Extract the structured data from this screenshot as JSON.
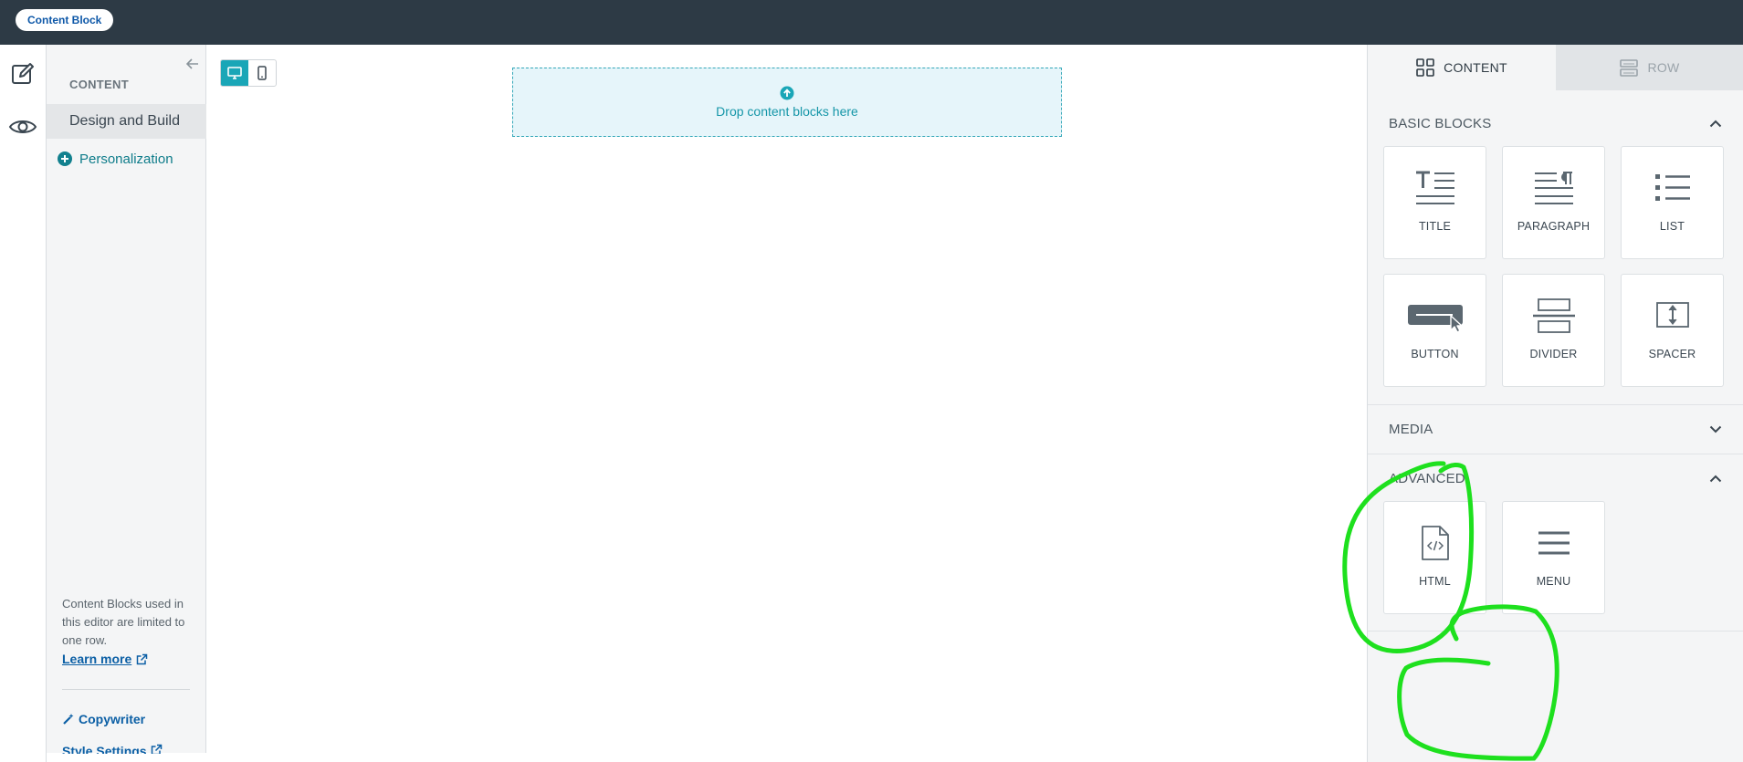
{
  "header": {
    "badge": "Content Block"
  },
  "rail": {
    "items": [
      {
        "icon": "edit-icon"
      },
      {
        "icon": "eye-icon"
      }
    ]
  },
  "nav": {
    "heading": "CONTENT",
    "active_item": "Design and Build",
    "personalization": "Personalization",
    "note": "Content Blocks used in this editor are limited to one row.",
    "learn_more": "Learn more",
    "copywriter": "Copywriter",
    "style_settings": "Style Settings"
  },
  "canvas": {
    "drop_text": "Drop content blocks here"
  },
  "sidebar": {
    "tabs": [
      {
        "label": "CONTENT",
        "icon": "grid-icon",
        "active": true
      },
      {
        "label": "ROW",
        "icon": "rows-icon",
        "active": false
      }
    ],
    "basic": {
      "title": "BASIC BLOCKS",
      "blocks": [
        "TITLE",
        "PARAGRAPH",
        "LIST",
        "BUTTON",
        "DIVIDER",
        "SPACER"
      ]
    },
    "media": {
      "title": "MEDIA"
    },
    "advanced": {
      "title": "ADVANCED",
      "blocks": [
        "HTML",
        "MENU"
      ]
    }
  },
  "colors": {
    "topbar": "#2d3a45",
    "accent": "#1aa6b7",
    "annotation": "#1ee01e"
  }
}
